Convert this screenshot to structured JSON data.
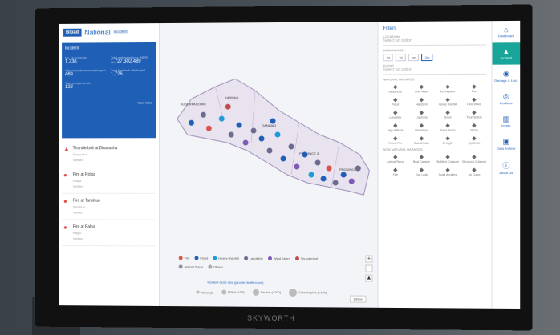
{
  "header": {
    "logo": "Bipad",
    "title": "National",
    "tag": "Incident"
  },
  "summary": {
    "heading": "Incident",
    "stats": [
      {
        "label": "No. of incidents",
        "value": "1,236"
      },
      {
        "label": "Total estimated loss (NPR)",
        "value": "1,727,302,489"
      },
      {
        "label": "Total infrastructure destroyed",
        "value": "469"
      },
      {
        "label": "Total livestock destroyed",
        "value": "1,726"
      },
      {
        "label": "Total people death",
        "value": "122"
      }
    ],
    "view_more": "View more"
  },
  "incidents": [
    {
      "title": "Thunderbolt at Dhanusha",
      "sub1": "Dhanusha",
      "sub2": "Verified"
    },
    {
      "title": "Fire at Rolpa",
      "sub1": "Rolpa",
      "sub2": "Verified"
    },
    {
      "title": "Fire at Tanahun",
      "sub1": "Tanahun",
      "sub2": "Verified"
    },
    {
      "title": "Fire at Palpa",
      "sub1": "Palpa",
      "sub2": "Verified"
    }
  ],
  "map": {
    "province_labels": [
      "SUDURPASCHIM",
      "KARNALI",
      "GANDAKI",
      "PROVINCE 3",
      "PROVINCE 1"
    ],
    "legend": [
      {
        "label": "Fire",
        "color": "#d9534f"
      },
      {
        "label": "Flood",
        "color": "#1f5fb5"
      },
      {
        "label": "Heavy Rainfall",
        "color": "#1c9bd6"
      },
      {
        "label": "Landslide",
        "color": "#6b6b8f"
      },
      {
        "label": "Wind Storm",
        "color": "#7b5bb6"
      },
      {
        "label": "Thunderbolt",
        "color": "#c24a4a"
      },
      {
        "label": "Animal Terror",
        "color": "#8a8fa8"
      },
      {
        "label": "Others",
        "color": "#aaaaaa"
      }
    ],
    "size_title": "Incident circle size (people death count)",
    "sizes": [
      "Minor (0)",
      "Major (<10)",
      "Severe (<100)",
      "Catastrophic (>100)"
    ],
    "zoom_in": "+",
    "zoom_out": "−",
    "north": "▲",
    "scale": "100km"
  },
  "filters": {
    "title": "Filters",
    "location_label": "LOCATION",
    "location_value": "Select an option",
    "data_range_label": "DATA RANGE",
    "days": [
      "3d",
      "7d",
      "1m",
      "2m"
    ],
    "active_day": "2m",
    "event_label": "EVENT",
    "event_value": "Select an option",
    "natural_label": "NATURAL HAZARDS",
    "natural": [
      "Avalanche",
      "Cold Wave",
      "Earthquake",
      "Fire",
      "Flood",
      "Hailstorm",
      "Heavy Rainfall",
      "Heat Wave",
      "Landslide",
      "Lightning",
      "Snow",
      "Thunderbolt",
      "High Altitude",
      "Windstorm",
      "Sand Storm",
      "Storm",
      "Forest Fire",
      "Glacial Lake",
      "Drought",
      "Epidemic"
    ],
    "non_natural_label": "NON NATURAL HAZARDS",
    "non_natural": [
      "Animal Terror",
      "Boat Capsize",
      "Building Collapse",
      "Structural Collapse",
      "Fire",
      "Gas Leak",
      "Road Accident",
      "Air Crash"
    ]
  },
  "rightbar": [
    {
      "icon": "home-icon",
      "label": "Dashboard"
    },
    {
      "icon": "warning-icon",
      "label": "Incident"
    },
    {
      "icon": "globe-icon",
      "label": "Damage & Loss"
    },
    {
      "icon": "realtime-icon",
      "label": "Realtime"
    },
    {
      "icon": "bar-chart-icon",
      "label": "Profile"
    },
    {
      "icon": "book-icon",
      "label": "Data Archive"
    },
    {
      "icon": "info-icon",
      "label": "About Us"
    }
  ],
  "brand": "SKYWORTH"
}
